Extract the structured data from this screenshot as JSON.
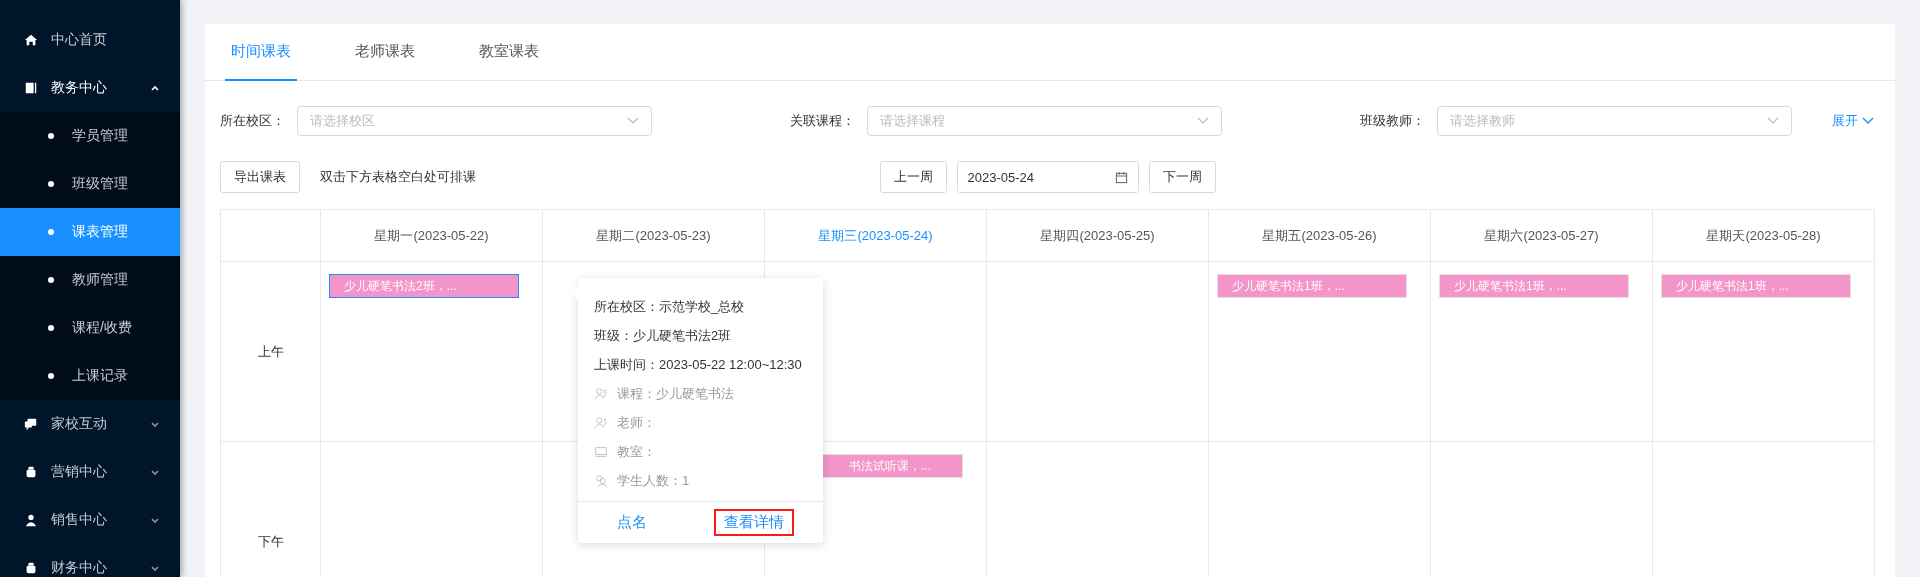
{
  "sidebar": {
    "items": [
      {
        "label": "中心首页"
      },
      {
        "label": "教务中心",
        "expanded": true,
        "children": [
          {
            "label": "学员管理",
            "selected": false
          },
          {
            "label": "班级管理",
            "selected": false
          },
          {
            "label": "课表管理",
            "selected": true
          },
          {
            "label": "教师管理",
            "selected": false
          },
          {
            "label": "课程/收费",
            "selected": false
          },
          {
            "label": "上课记录",
            "selected": false
          }
        ]
      },
      {
        "label": "家校互动",
        "expanded": false
      },
      {
        "label": "营销中心",
        "expanded": false
      },
      {
        "label": "销售中心",
        "expanded": false
      },
      {
        "label": "财务中心",
        "expanded": false
      }
    ]
  },
  "tabs": [
    {
      "label": "时间课表",
      "selected": true
    },
    {
      "label": "老师课表",
      "selected": false
    },
    {
      "label": "教室课表",
      "selected": false
    }
  ],
  "filters": [
    {
      "label": "所在校区：",
      "placeholder": "请选择校区"
    },
    {
      "label": "关联课程：",
      "placeholder": "请选择课程"
    },
    {
      "label": "班级教师：",
      "placeholder": "请选择教师"
    }
  ],
  "expand_link": "展开",
  "export_button": "导出课表",
  "hint": "双击下方表格空白处可排课",
  "prev_week": "上一周",
  "date": "2023-05-24",
  "next_week": "下一周",
  "days": [
    {
      "label": "星期一(2023-05-22)",
      "today": false
    },
    {
      "label": "星期二(2023-05-23)",
      "today": false
    },
    {
      "label": "星期三(2023-05-24)",
      "today": true
    },
    {
      "label": "星期四(2023-05-25)",
      "today": false
    },
    {
      "label": "星期五(2023-05-26)",
      "today": false
    },
    {
      "label": "星期六(2023-05-27)",
      "today": false
    },
    {
      "label": "星期天(2023-05-28)",
      "today": false
    }
  ],
  "rows": [
    {
      "label": "上午",
      "cells": [
        [
          {
            "text": "少儿硬笔书法2班，...",
            "selected": true,
            "color": "#f395c8"
          }
        ],
        [],
        [],
        [],
        [
          {
            "text": "少儿硬笔书法1班，...",
            "selected": false,
            "color": "#f395c8"
          }
        ],
        [
          {
            "text": "少儿硬笔书法1班，...",
            "selected": false,
            "color": "#f395c8"
          }
        ],
        [
          {
            "text": "少儿硬笔书法1班，...",
            "selected": false,
            "color": "#f395c8"
          }
        ]
      ]
    },
    {
      "label": "下午",
      "cells": [
        [],
        [],
        [
          {
            "text": "书法试听课，...",
            "selected": false,
            "color": "#f395c8"
          }
        ],
        [],
        [],
        [],
        []
      ]
    }
  ],
  "popover": {
    "lines": [
      {
        "kind": "plain",
        "text": "所在校区：示范学校_总校"
      },
      {
        "kind": "plain",
        "text": "班级：少儿硬笔书法2班"
      },
      {
        "kind": "plain",
        "text": "上课时间：2023-05-22 12:00~12:30"
      },
      {
        "kind": "course",
        "text": "课程：少儿硬笔书法"
      },
      {
        "kind": "teacher",
        "text": "老师："
      },
      {
        "kind": "room",
        "text": "教室："
      },
      {
        "kind": "students",
        "text": "学生人数：1"
      }
    ],
    "actions": [
      {
        "label": "点名",
        "highlighted": false
      },
      {
        "label": "查看详情",
        "highlighted": true
      }
    ]
  }
}
